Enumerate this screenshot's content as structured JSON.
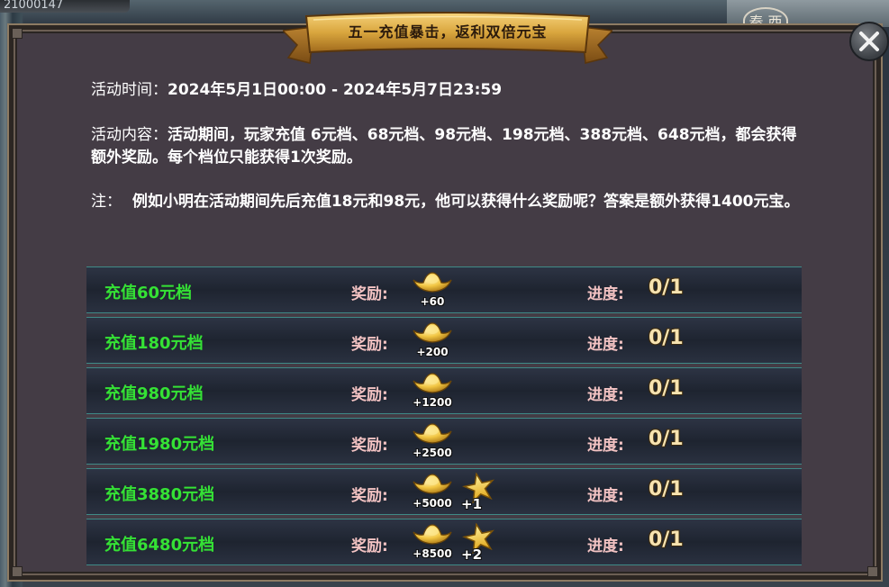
{
  "top_counter": "21000147",
  "map_corner": "秦 西",
  "banner": {
    "title": "五一充值暴击，返利双倍元宝"
  },
  "info": {
    "time_label": "活动时间：",
    "time_value": "2024年5月1日00:00 - 2024年5月7日23:59",
    "content_label": "活动内容：",
    "content_value": "活动期间，玩家充值 6元档、68元档、98元档、198元档、388元档、648元档，都会获得额外奖励。每个档位只能获得1次奖励。",
    "note_label": "注：",
    "note_value": "例如小明在活动期间先后充值18元和98元，他可以获得什么奖励呢？答案是额外获得1400元宝。"
  },
  "reward_label": "奖励:",
  "progress_label": "进度:",
  "tiers": [
    {
      "title": "充值60元档",
      "ingot": "+60",
      "star": null,
      "progress": "0/1"
    },
    {
      "title": "充值180元档",
      "ingot": "+200",
      "star": null,
      "progress": "0/1"
    },
    {
      "title": "充值980元档",
      "ingot": "+1200",
      "star": null,
      "progress": "0/1"
    },
    {
      "title": "充值1980元档",
      "ingot": "+2500",
      "star": null,
      "progress": "0/1"
    },
    {
      "title": "充值3880元档",
      "ingot": "+5000",
      "star": "+1",
      "progress": "0/1"
    },
    {
      "title": "充值6480元档",
      "ingot": "+8500",
      "star": "+2",
      "progress": "0/1"
    }
  ],
  "colors": {
    "tier_title": "#35e235",
    "label": "#f3c3c3",
    "panel": "#443c45",
    "banner": "#d9a63e"
  },
  "icons": {
    "close": "close-icon",
    "ingot": "gold-ingot-icon",
    "star": "gold-star-icon"
  }
}
